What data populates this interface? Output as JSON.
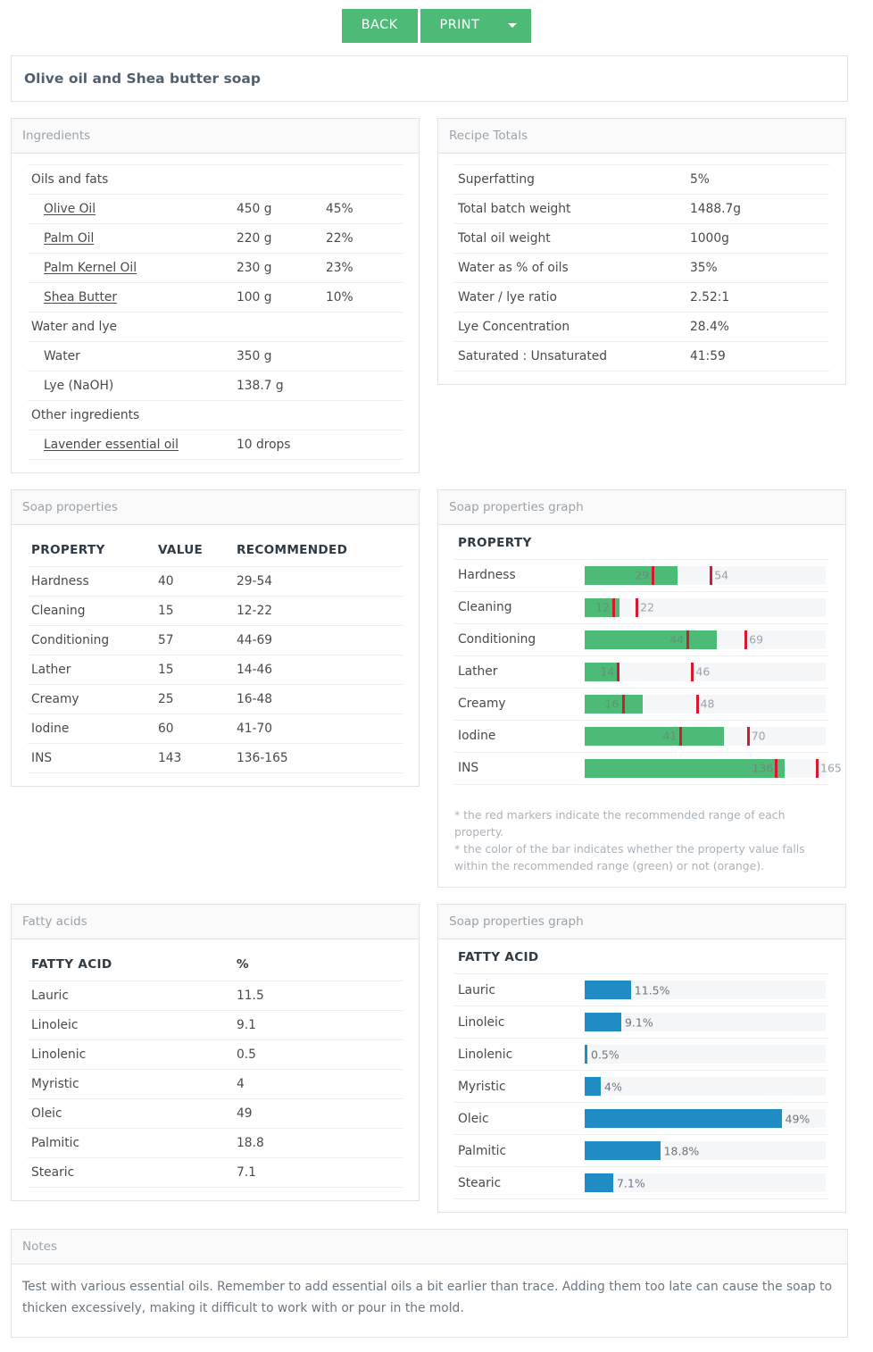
{
  "toolbar": {
    "back_label": "BACK",
    "print_label": "PRINT",
    "dropdown_icon": "chevron-down-icon",
    "accent_color": "#4CBB77"
  },
  "recipe_title": "Olive oil and Shea butter soap",
  "ingredients": {
    "panel_title": "Ingredients",
    "groups": [
      {
        "name": "Oils and fats",
        "rows": [
          {
            "name": "Olive Oil",
            "amount": "450 g",
            "percent": "45%",
            "link": true
          },
          {
            "name": "Palm Oil",
            "amount": "220 g",
            "percent": "22%",
            "link": true
          },
          {
            "name": "Palm Kernel Oil",
            "amount": "230 g",
            "percent": "23%",
            "link": true
          },
          {
            "name": "Shea Butter",
            "amount": "100 g",
            "percent": "10%",
            "link": true
          }
        ]
      },
      {
        "name": "Water and lye",
        "rows": [
          {
            "name": "Water",
            "amount": "350 g",
            "percent": "",
            "link": false
          },
          {
            "name": "Lye (NaOH)",
            "amount": "138.7 g",
            "percent": "",
            "link": false
          }
        ]
      },
      {
        "name": "Other ingredients",
        "rows": [
          {
            "name": "Lavender essential oil",
            "amount": "10 drops",
            "percent": "",
            "link": true
          }
        ]
      }
    ]
  },
  "totals": {
    "panel_title": "Recipe Totals",
    "rows": [
      {
        "label": "Superfatting",
        "value": "5%"
      },
      {
        "label": "Total batch weight",
        "value": "1488.7g"
      },
      {
        "label": "Total oil weight",
        "value": "1000g"
      },
      {
        "label": "Water as % of oils",
        "value": "35%"
      },
      {
        "label": "Water / lye ratio",
        "value": "2.52:1"
      },
      {
        "label": "Lye Concentration",
        "value": "28.4%"
      },
      {
        "label": "Saturated : Unsaturated",
        "value": "41:59"
      }
    ]
  },
  "soap_properties": {
    "panel_title": "Soap properties",
    "headers": {
      "property": "PROPERTY",
      "value": "VALUE",
      "recommended": "RECOMMENDED"
    },
    "rows": [
      {
        "property": "Hardness",
        "value": "40",
        "recommended": "29-54"
      },
      {
        "property": "Cleaning",
        "value": "15",
        "recommended": "12-22"
      },
      {
        "property": "Conditioning",
        "value": "57",
        "recommended": "44-69"
      },
      {
        "property": "Lather",
        "value": "15",
        "recommended": "14-46"
      },
      {
        "property": "Creamy",
        "value": "25",
        "recommended": "16-48"
      },
      {
        "property": "Iodine",
        "value": "60",
        "recommended": "41-70"
      },
      {
        "property": "INS",
        "value": "143",
        "recommended": "136-165"
      }
    ]
  },
  "soap_graph": {
    "panel_title": "Soap properties graph",
    "header": "PROPERTY",
    "footnotes": [
      "* the red markers indicate the recommended range of each property.",
      "* the color of the bar indicates whether the property value falls within the recommended range (green) or not (orange)."
    ],
    "bar_color_in_range": "#4CBB77",
    "bar_color_out_of_range": "#e8883a",
    "marker_color": "#d6192e"
  },
  "fatty_acids": {
    "panel_title": "Fatty acids",
    "headers": {
      "name": "FATTY ACID",
      "percent": "%"
    },
    "rows": [
      {
        "name": "Lauric",
        "percent": "11.5"
      },
      {
        "name": "Linoleic",
        "percent": "9.1"
      },
      {
        "name": "Linolenic",
        "percent": "0.5"
      },
      {
        "name": "Myristic",
        "percent": "4"
      },
      {
        "name": "Oleic",
        "percent": "49"
      },
      {
        "name": "Palmitic",
        "percent": "18.8"
      },
      {
        "name": "Stearic",
        "percent": "7.1"
      }
    ]
  },
  "fatty_graph": {
    "panel_title": "Soap properties graph",
    "header": "FATTY ACID",
    "bar_color": "#1f8dc4"
  },
  "notes": {
    "panel_title": "Notes",
    "text": "Test with various essential oils. Remember to add essential oils a bit earlier than trace. Adding them too late can cause the soap to thicken excessively, making it difficult to work with or pour in the mold."
  },
  "chart_data": [
    {
      "type": "bar",
      "title": "Soap properties graph",
      "xlabel": "",
      "ylabel": "PROPERTY",
      "orientation": "horizontal",
      "grid": false,
      "legend": "none",
      "categories": [
        "Hardness",
        "Cleaning",
        "Conditioning",
        "Lather",
        "Creamy",
        "Iodine",
        "INS"
      ],
      "values": [
        40,
        15,
        57,
        15,
        25,
        60,
        143
      ],
      "recommended_min": [
        29,
        12,
        44,
        14,
        16,
        41,
        136
      ],
      "recommended_max": [
        54,
        22,
        69,
        46,
        48,
        70,
        165
      ],
      "in_range": [
        true,
        true,
        true,
        true,
        true,
        true,
        true
      ],
      "scale_max": [
        104,
        104,
        104,
        104,
        104,
        104,
        172
      ],
      "bar_color": "#4CBB77",
      "marker_color": "#d6192e"
    },
    {
      "type": "bar",
      "title": "Soap properties graph",
      "xlabel": "%",
      "ylabel": "FATTY ACID",
      "orientation": "horizontal",
      "grid": false,
      "legend": "none",
      "categories": [
        "Lauric",
        "Linoleic",
        "Linolenic",
        "Myristic",
        "Oleic",
        "Palmitic",
        "Stearic"
      ],
      "values": [
        11.5,
        9.1,
        0.5,
        4,
        49,
        18.8,
        7.1
      ],
      "labels": [
        "11.5%",
        "9.1%",
        "0.5%",
        "4%",
        "49%",
        "18.8%",
        "7.1%"
      ],
      "xlim": [
        0,
        60
      ],
      "bar_color": "#1f8dc4"
    }
  ]
}
